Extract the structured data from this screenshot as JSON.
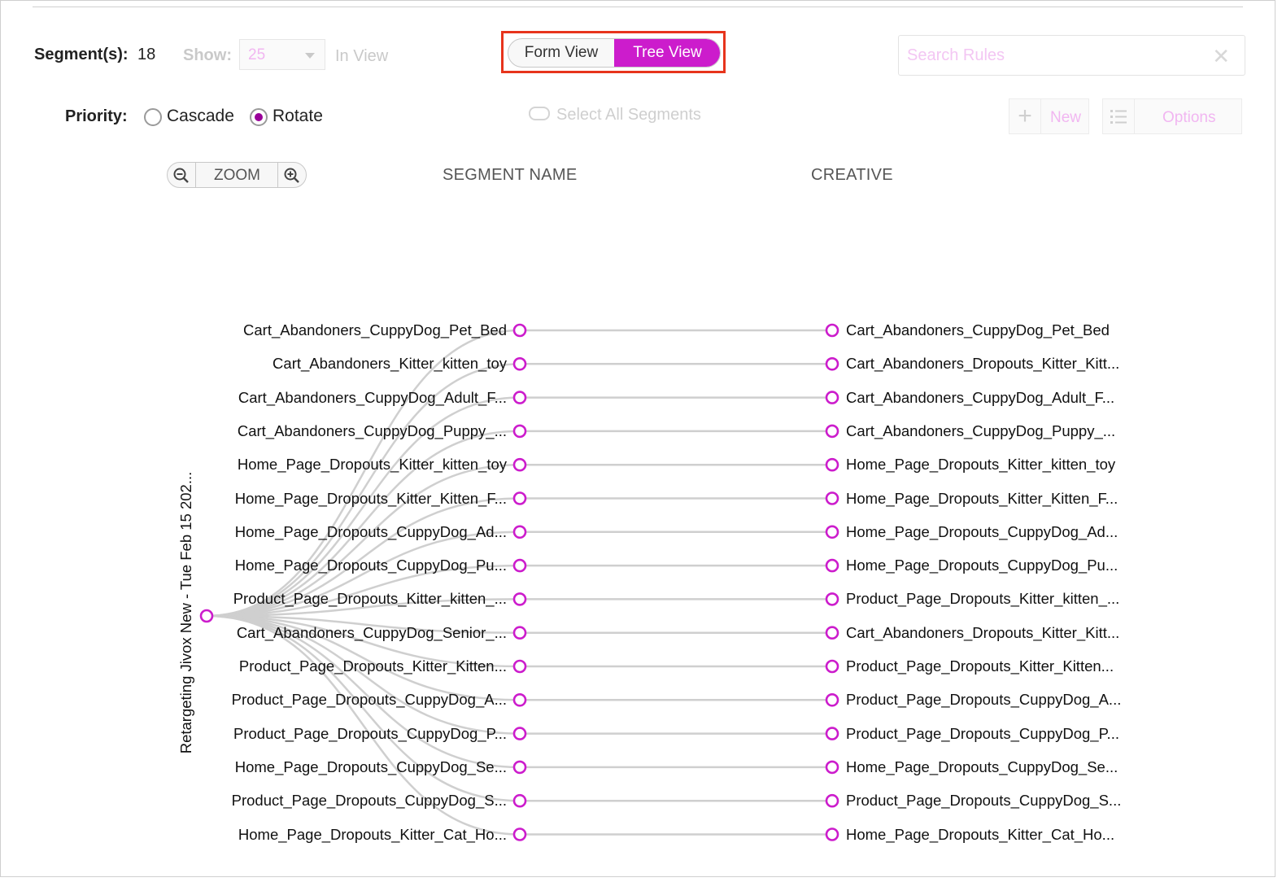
{
  "header": {
    "segments_label": "Segment(s):",
    "segments_count": "18",
    "show_label": "Show:",
    "show_value": "25",
    "in_view": "In View",
    "form_view": "Form View",
    "tree_view": "Tree View",
    "search_placeholder": "Search Rules"
  },
  "priority": {
    "label": "Priority:",
    "cascade": "Cascade",
    "rotate": "Rotate",
    "selected": "Rotate"
  },
  "actions": {
    "select_all": "Select All Segments",
    "new_label": "New",
    "options_label": "Options"
  },
  "tree": {
    "zoom_label": "ZOOM",
    "segment_header": "SEGMENT NAME",
    "creative_header": "CREATIVE",
    "root_label": "Retargeting Jivox New - Tue Feb 15 202...",
    "accent": "#cc1ccc",
    "rows": [
      {
        "segment": "Cart_Abandoners_CuppyDog_Pet_Bed",
        "creative": "Cart_Abandoners_CuppyDog_Pet_Bed"
      },
      {
        "segment": "Cart_Abandoners_Kitter_kitten_toy",
        "creative": "Cart_Abandoners_Dropouts_Kitter_Kitt..."
      },
      {
        "segment": "Cart_Abandoners_CuppyDog_Adult_F...",
        "creative": "Cart_Abandoners_CuppyDog_Adult_F..."
      },
      {
        "segment": "Cart_Abandoners_CuppyDog_Puppy_...",
        "creative": "Cart_Abandoners_CuppyDog_Puppy_..."
      },
      {
        "segment": "Home_Page_Dropouts_Kitter_kitten_toy",
        "creative": "Home_Page_Dropouts_Kitter_kitten_toy"
      },
      {
        "segment": "Home_Page_Dropouts_Kitter_Kitten_F...",
        "creative": "Home_Page_Dropouts_Kitter_Kitten_F..."
      },
      {
        "segment": "Home_Page_Dropouts_CuppyDog_Ad...",
        "creative": "Home_Page_Dropouts_CuppyDog_Ad..."
      },
      {
        "segment": "Home_Page_Dropouts_CuppyDog_Pu...",
        "creative": "Home_Page_Dropouts_CuppyDog_Pu..."
      },
      {
        "segment": "Product_Page_Dropouts_Kitter_kitten_...",
        "creative": "Product_Page_Dropouts_Kitter_kitten_..."
      },
      {
        "segment": "Cart_Abandoners_CuppyDog_Senior_...",
        "creative": "Cart_Abandoners_Dropouts_Kitter_Kitt..."
      },
      {
        "segment": "Product_Page_Dropouts_Kitter_Kitten...",
        "creative": "Product_Page_Dropouts_Kitter_Kitten..."
      },
      {
        "segment": "Product_Page_Dropouts_CuppyDog_A...",
        "creative": "Product_Page_Dropouts_CuppyDog_A..."
      },
      {
        "segment": "Product_Page_Dropouts_CuppyDog_P...",
        "creative": "Product_Page_Dropouts_CuppyDog_P..."
      },
      {
        "segment": "Home_Page_Dropouts_CuppyDog_Se...",
        "creative": "Home_Page_Dropouts_CuppyDog_Se..."
      },
      {
        "segment": "Product_Page_Dropouts_CuppyDog_S...",
        "creative": "Product_Page_Dropouts_CuppyDog_S..."
      },
      {
        "segment": "Home_Page_Dropouts_Kitter_Cat_Ho...",
        "creative": "Home_Page_Dropouts_Kitter_Cat_Ho..."
      }
    ]
  }
}
